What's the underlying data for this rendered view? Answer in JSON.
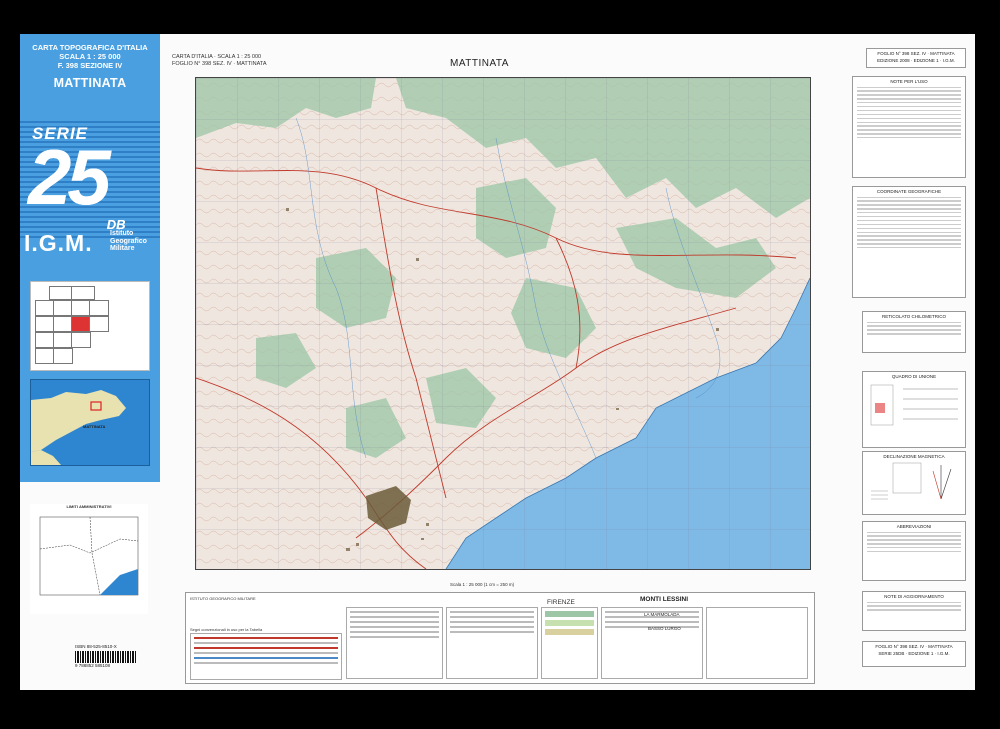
{
  "cover": {
    "header_line1": "CARTA TOPOGRAFICA D'ITALIA",
    "header_line2": "SCALA 1 : 25 000",
    "header_line3": "F. 398 SEZIONE IV",
    "title": "MATTINATA",
    "serie_label": "SERIE",
    "serie_number": "25",
    "serie_suffix": "DB",
    "igm_logo": "I.G.M.",
    "igm_sub1": "Istituto",
    "igm_sub2": "Geografico",
    "igm_sub3": "Militare",
    "inset_label": "MATTINATA",
    "admin_title": "LIMITI AMMINISTRATIVI",
    "isbn": "ISBN 88-525-8510-X",
    "barcode_number": "9 788852 585108"
  },
  "map": {
    "frame_title_line1": "CARTA D'ITALIA · SCALA 1 : 25 000",
    "frame_title_line2": "FOGLIO N° 398 SEZ. IV · MATTINATA",
    "title": "MATTINATA",
    "scale_text": "Scala 1 : 25 000 (1 cm = 250 m)",
    "colors": {
      "land": "#efe7df",
      "forest": "#9cc6a6",
      "sea": "#7fb9e6",
      "contour": "#c98a76",
      "road": "#c0392b",
      "town": "#6b5a3a"
    }
  },
  "legend": {
    "institute": "ISTITUTO GEOGRAFICO MILITARE",
    "segni": "Segni convenzionali in uso per la Tabella",
    "firenze": "FIRENZE",
    "monti": "MONTI LESSINI",
    "marmolada": "LA MARMOLADA",
    "basso": "BASSO LURGO"
  },
  "right": {
    "top_title": "FOGLIO N° 398 SEZ. IV · MATTINATA",
    "top_sub": "EDIZIONE 2008 · EDIZIONE 1 · I.G.M.",
    "box1_head": "NOTE PER L'USO",
    "box2_head": "COORDINATE GEOGRAFICHE",
    "box3_head": "RETICOLATO CHILOMETRICO",
    "box4_head": "QUADRO DI UNIONE",
    "box5_head": "DECLINAZIONE MAGNETICA",
    "box6_head": "ABBREVIAZIONI",
    "box7_head": "NOTE DI AGGIORNAMENTO",
    "bottom_id_line1": "FOGLIO N° 398 SEZ. IV · MATTINATA",
    "bottom_id_line2": "SERIE 25DB · EDIZIONE 1 · I.G.M."
  }
}
